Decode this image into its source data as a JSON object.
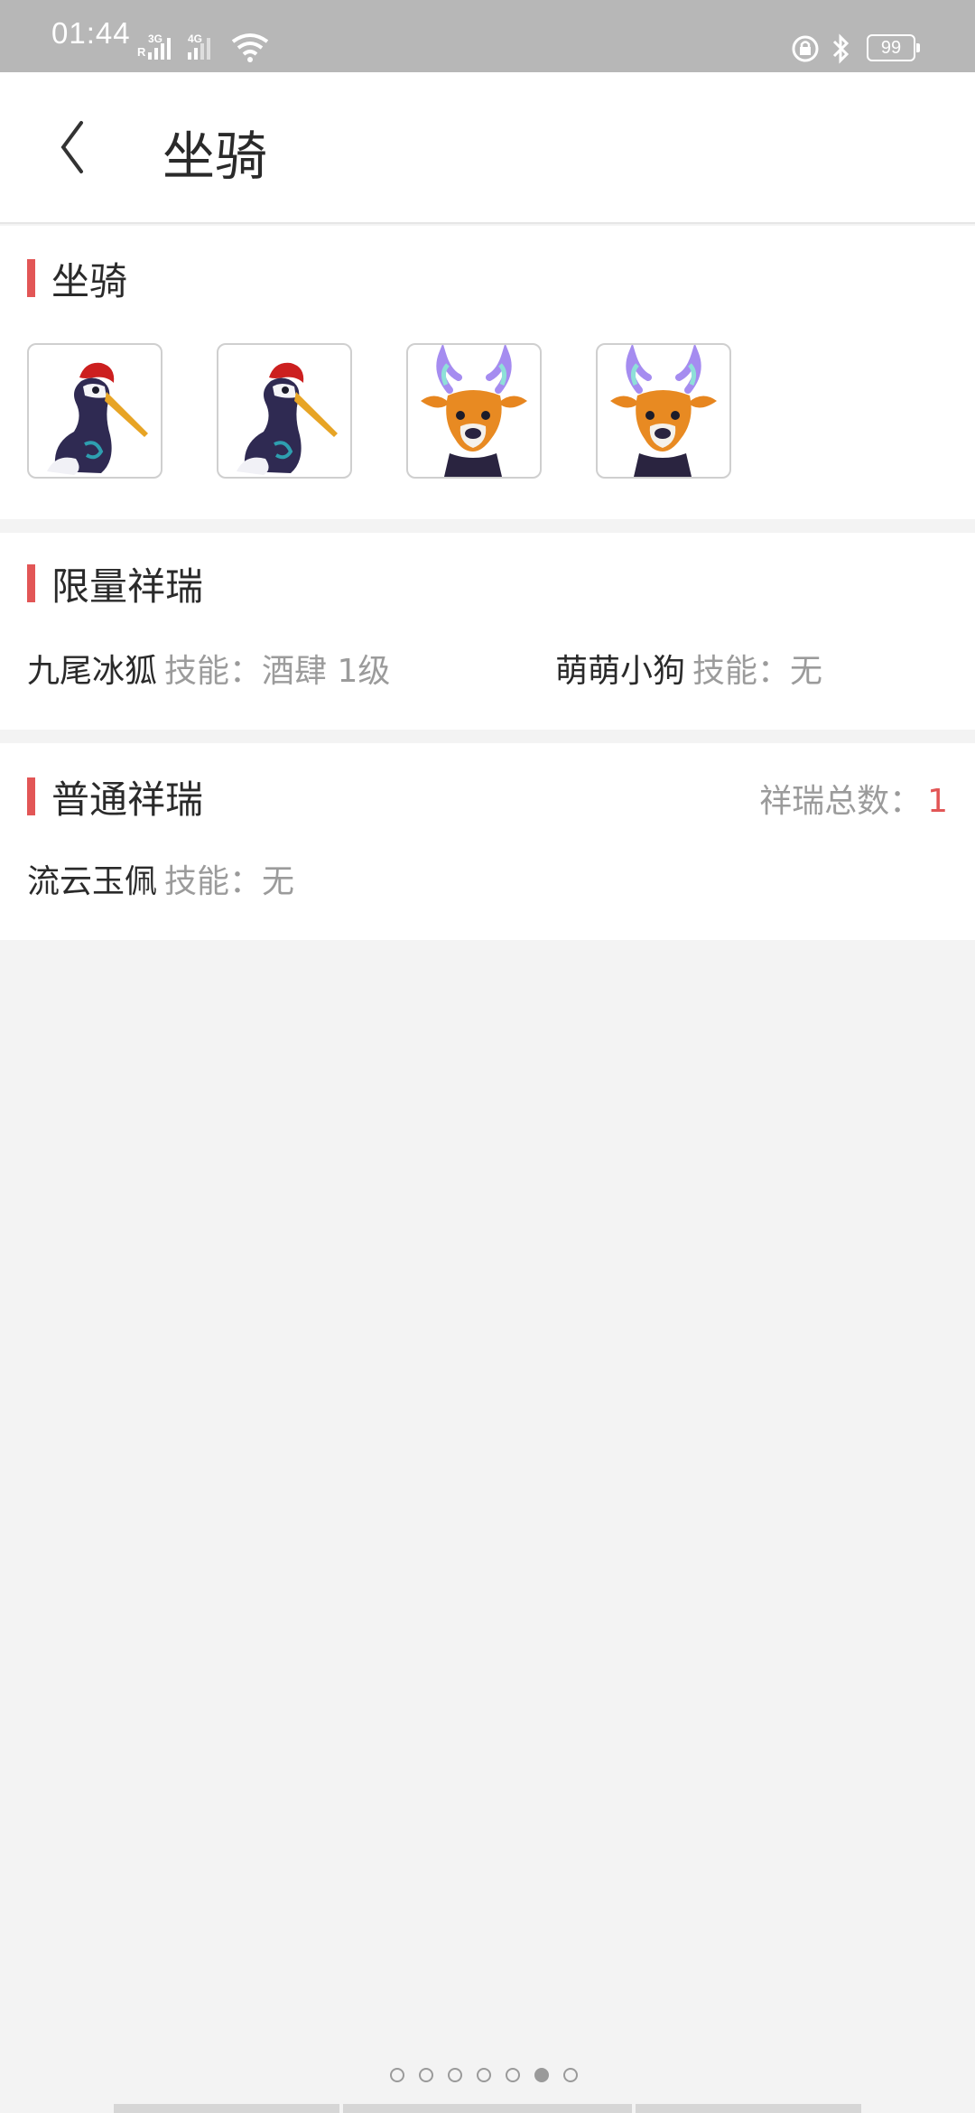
{
  "status_bar": {
    "time": "01:44",
    "network_r": "R",
    "network_3g": "3G",
    "network_4g": "4G",
    "battery": "99",
    "icons": [
      "signal-icon",
      "wifi-icon",
      "lock-rotation-icon",
      "bluetooth-icon",
      "battery-icon"
    ]
  },
  "header": {
    "title": "坐骑",
    "back_icon": "chevron-left-icon"
  },
  "mounts_section": {
    "title": "坐骑",
    "items": [
      {
        "icon": "crane-mount-icon"
      },
      {
        "icon": "crane-mount-icon"
      },
      {
        "icon": "deer-mount-icon"
      },
      {
        "icon": "deer-mount-icon"
      }
    ]
  },
  "limited_section": {
    "title": "限量祥瑞",
    "entries": [
      {
        "name": "九尾冰狐",
        "skill_label": "技能：",
        "skill_value": "酒肆 1级"
      },
      {
        "name": "萌萌小狗",
        "skill_label": "技能：",
        "skill_value": "无"
      }
    ]
  },
  "normal_section": {
    "title": "普通祥瑞",
    "total_label": "祥瑞总数：",
    "total_value": "1",
    "entries": [
      {
        "name": "流云玉佩",
        "skill_label": "技能：",
        "skill_value": "无"
      }
    ]
  },
  "pager": {
    "total_pages": 7,
    "active_index": 5
  },
  "colors": {
    "accent": "#e25656",
    "status_bar": "#b7b7b7",
    "background": "#f3f3f3"
  }
}
